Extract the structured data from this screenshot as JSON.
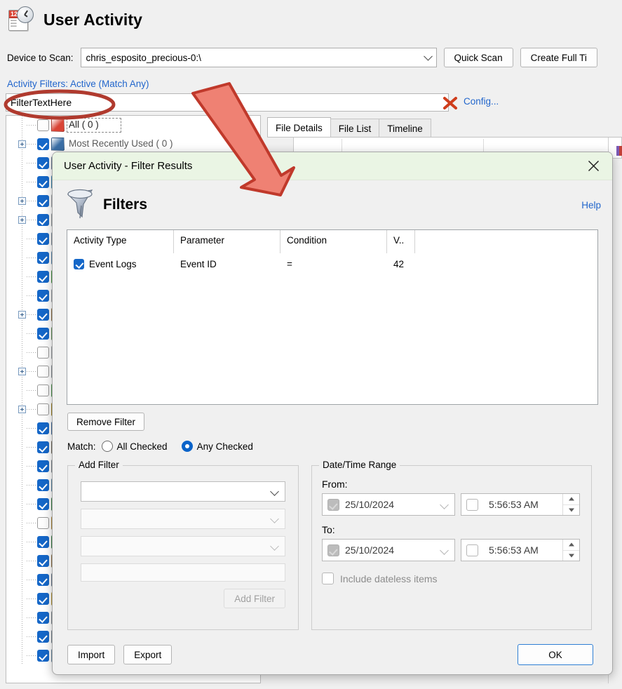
{
  "app": {
    "title": "User Activity",
    "icon": "calendar-clock-icon",
    "device_label": "Device to Scan:",
    "device_value": "chris_esposito_precious-0:\\",
    "quick_scan": "Quick Scan",
    "create_full_timeline": "Create Full Ti",
    "activity_filters_link": "Activity Filters: Active (Match Any)",
    "filter_text_value": "FilterTextHere",
    "clear_icon": "red-x-clear-icon",
    "config_link": "Config...",
    "tabs": [
      {
        "label": "File Details",
        "active": true
      },
      {
        "label": "File List",
        "active": false
      },
      {
        "label": "Timeline",
        "active": false
      }
    ]
  },
  "tree": {
    "items": [
      {
        "label": "All ( 0 )",
        "checked": false,
        "expandable": false,
        "selected": true,
        "icon_color": "#d94436"
      },
      {
        "label": "Most Recently Used ( 0 )",
        "checked": true,
        "expandable": true,
        "icon_color": "#3a6ea5"
      },
      {
        "label": "",
        "checked": true,
        "expandable": false,
        "icon_color": "#7f9ab5"
      },
      {
        "label": "",
        "checked": true,
        "expandable": false,
        "icon_color": "#3fa0d8"
      },
      {
        "label": "",
        "checked": true,
        "expandable": true,
        "icon_color": "#c8ced6"
      },
      {
        "label": "",
        "checked": true,
        "expandable": true,
        "icon_color": "#b9bfc7"
      },
      {
        "label": "",
        "checked": true,
        "expandable": false,
        "icon_color": "#9fb0c2"
      },
      {
        "label": "",
        "checked": true,
        "expandable": false,
        "icon_color": "#6fa8dc"
      },
      {
        "label": "",
        "checked": true,
        "expandable": false,
        "icon_color": "#53b84f"
      },
      {
        "label": "",
        "checked": true,
        "expandable": false,
        "icon_color": "#c0c6cd"
      },
      {
        "label": "",
        "checked": true,
        "expandable": true,
        "icon_color": "#b08a50"
      },
      {
        "label": "",
        "checked": true,
        "expandable": false,
        "icon_color": "#76b36b"
      },
      {
        "label": "",
        "checked": false,
        "expandable": false,
        "icon_color": "#c4c9cf"
      },
      {
        "label": "",
        "checked": false,
        "expandable": true,
        "icon_color": "#a8b2bc"
      },
      {
        "label": "",
        "checked": false,
        "expandable": false,
        "icon_color": "#5cb85c"
      },
      {
        "label": "",
        "checked": false,
        "expandable": true,
        "icon_color": "#c9a227"
      },
      {
        "label": "",
        "checked": true,
        "expandable": false,
        "icon_color": "#4a7fc1"
      },
      {
        "label": "",
        "checked": true,
        "expandable": false,
        "icon_color": "#8a7f6f"
      },
      {
        "label": "",
        "checked": true,
        "expandable": false,
        "icon_color": "#9aa5ae"
      },
      {
        "label": "",
        "checked": true,
        "expandable": false,
        "icon_color": "#6ba3c9"
      },
      {
        "label": "",
        "checked": true,
        "expandable": false,
        "icon_color": "#3f9a4f"
      },
      {
        "label": "",
        "checked": false,
        "expandable": false,
        "icon_color": "#d9a441"
      },
      {
        "label": "",
        "checked": true,
        "expandable": false,
        "icon_color": "#3f9a4f"
      },
      {
        "label": "",
        "checked": true,
        "expandable": false,
        "icon_color": "#b08a50"
      },
      {
        "label": "",
        "checked": true,
        "expandable": false,
        "icon_color": "#7b93ab"
      },
      {
        "label": "",
        "checked": true,
        "expandable": false,
        "icon_color": "#e0b83c"
      },
      {
        "label": "",
        "checked": true,
        "expandable": false,
        "icon_color": "#9aa5ae"
      },
      {
        "label": "",
        "checked": true,
        "expandable": false,
        "icon_color": "#8fa0b0"
      },
      {
        "label": "",
        "checked": true,
        "expandable": false,
        "icon_color": "#7fa8c8"
      }
    ]
  },
  "dialog": {
    "title": "User Activity - Filter Results",
    "close_icon": "close-x-icon",
    "heading": "Filters",
    "heading_icon": "funnel-icon",
    "help_link": "Help",
    "grid": {
      "columns": [
        "Activity Type",
        "Parameter",
        "Condition",
        "V.."
      ],
      "rows": [
        {
          "activity_type": "Event Logs",
          "checked": true,
          "parameter": "Event ID",
          "condition": "=",
          "value": "42"
        }
      ]
    },
    "remove_filter": "Remove Filter",
    "match": {
      "label": "Match:",
      "options": [
        {
          "label": "All Checked",
          "selected": false
        },
        {
          "label": "Any Checked",
          "selected": true
        }
      ]
    },
    "add_filter": {
      "legend": "Add Filter",
      "select1": "",
      "select2": "",
      "select3": "",
      "textvalue": "",
      "button": "Add Filter"
    },
    "date_range": {
      "legend": "Date/Time Range",
      "from_label": "From:",
      "from_date": "25/10/2024",
      "from_time": "5:56:53 AM",
      "to_label": "To:",
      "to_date": "25/10/2024",
      "to_time": "5:56:53 AM",
      "dateless_label": "Include dateless items"
    },
    "import": "Import",
    "export": "Export",
    "ok": "OK"
  },
  "annotations": {
    "ellipse": "red-ellipse-highlight",
    "arrow": "red-arrow-pointer"
  },
  "colors": {
    "accent_link": "#2266cc",
    "checkbox_blue": "#1567c8",
    "dialog_titlebar": "#eaf5e4",
    "annotation_red": "#c0392b",
    "annotation_fill": "#ef8173"
  }
}
